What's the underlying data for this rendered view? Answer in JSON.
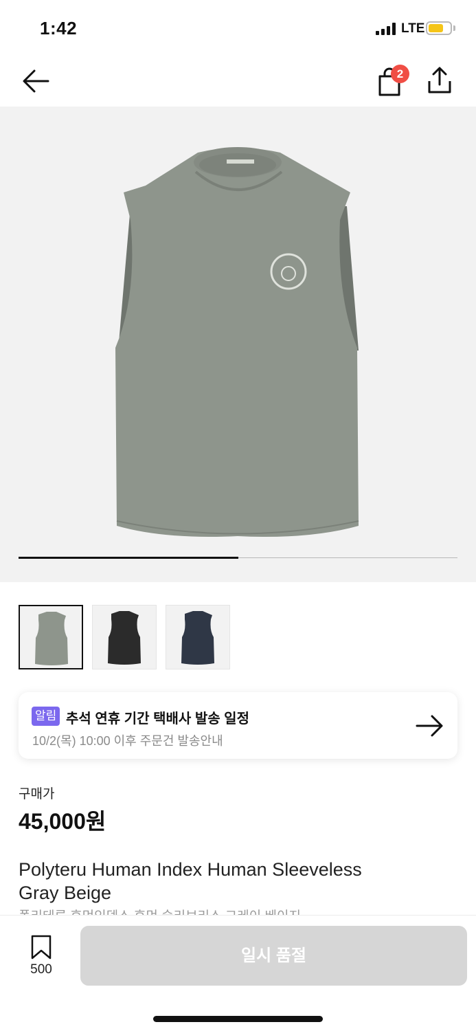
{
  "status_bar": {
    "time": "1:42",
    "network": "LTE",
    "battery_color": "#f5c518"
  },
  "nav": {
    "back_icon": "arrow-left-icon",
    "cart_icon": "shopping-bag-icon",
    "cart_badge": "2",
    "share_icon": "share-icon"
  },
  "gallery": {
    "image": "gray-sleeveless-top",
    "progress_fraction": 0.5
  },
  "thumbnails": [
    {
      "color": "Gray Beige",
      "fill": "#8e958c",
      "selected": true
    },
    {
      "color": "Black",
      "fill": "#2b2b2b",
      "selected": false
    },
    {
      "color": "Navy",
      "fill": "#2f3746",
      "selected": false
    }
  ],
  "notice": {
    "tag": "알림",
    "title": "추석 연휴 기간 택배사 발송 일정",
    "subtitle": "10/2(목) 10:00 이후 주문건 발송안내",
    "icon": "arrow-right-icon"
  },
  "price": {
    "label": "구매가",
    "value": "45,000원"
  },
  "product": {
    "name": "Polyteru Human Index Human Sleeveless Gray Beige",
    "name_ko": "폴리테루 휴먼인덱스 휴먼 슬리브리스 그레이 베이지"
  },
  "bottom_bar": {
    "bookmark_icon": "bookmark-icon",
    "bookmark_count": "500",
    "buy_button": "일시 품절"
  },
  "colors": {
    "accent": "#7b68ee",
    "badge": "#f04e45",
    "disabled_button": "#d6d6d6"
  }
}
